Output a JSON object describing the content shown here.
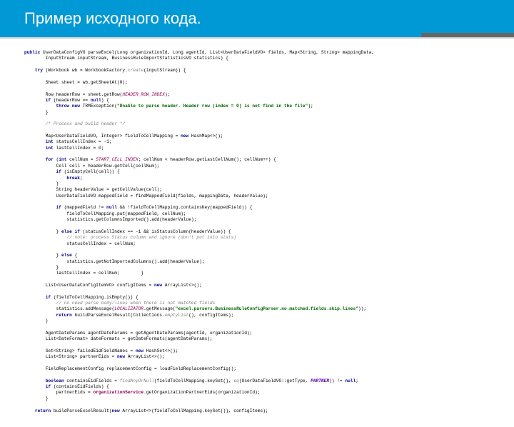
{
  "header": {
    "title": "Пример исходного кода."
  },
  "code": {
    "l01a": "public",
    "l01b": " UserDataConfigVO parseExcel(Long organizationId, Long agentId, List<UserDataFieldVO> fields, Map<String, String> mappingData,",
    "l02": "        InputStream inputStream, BusinessRuleImportStatisticsVO statistics) {",
    "l03a": "    try",
    "l03b": " (Workbook wb = WorkbookFactory.",
    "l03c": "create",
    "l03d": "(inputStream)) {",
    "l04": "        Sheet sheet = wb.getSheetAt(0);",
    "l05a": "        Row headerRow = sheet.getRow(",
    "l05b": "HEADER_ROW_INDEX",
    "l05c": ");",
    "l06a": "        if",
    "l06b": " (headerRow == ",
    "l06c": "null",
    "l06d": ") {",
    "l07a": "            throw new",
    "l07b": " TRMException(",
    "l07c": "\"Unable to parse header. Header row (index = 0) is not find in the file\"",
    "l07d": ");",
    "l08": "        }",
    "l09": "        /* Process and build header */",
    "l10a": "        Map<UserDataFieldVO, Integer> fieldToCellMapping = ",
    "l10b": "new",
    "l10c": " HashMap<>();",
    "l11a": "        int",
    "l11b": " statusCellIndex = -1;",
    "l12a": "        int",
    "l12b": " lastCellIndex = 0;",
    "l13a": "        for",
    "l13b": " (",
    "l13c": "int",
    "l13d": " cellNum = ",
    "l13e": "START_CELL_INDEX",
    "l13f": "; cellNum < headerRow.getLastCellNum(); cellNum++) {",
    "l14": "            Cell cell = headerRow.getCell(cellNum);",
    "l15a": "            if",
    "l15b": " (isEmptyCell(cell)) {",
    "l16": "                break;",
    "l17": "            }",
    "l18": "            String headerValue = getCellValue(cell);",
    "l19": "            UserDataFieldVO mappedField = findMappedField(fields, mappingData, headerValue);",
    "l20a": "            if",
    "l20b": " (mappedField != ",
    "l20c": "null",
    "l20d": " && !fieldToCellMapping.containsKey(mappedField)) {",
    "l21": "                fieldToCellMapping.put(mappedField, cellNum);",
    "l22": "                statistics.getColumnsImported().add(headerValue);",
    "l23a": "            } ",
    "l23b": "else if",
    "l23c": " (statusCellIndex == -1 && isStatusColumn(headerValue)) {",
    "l24": "                // note: process Status column and ignore (don't put into stats)",
    "l25": "                statusCellIndex = cellNum;",
    "l26a": "            } ",
    "l26b": "else",
    "l26c": " {",
    "l27": "                statistics.getNotImportedColumns().add(headerValue);",
    "l28": "            }",
    "l29": "            lastCellIndex = cellNum;        }",
    "l30a": "        List<UserDataConfigItemVO> configItems = ",
    "l30b": "new",
    "l30c": " ArrayList<>();",
    "l31a": "        if",
    "l31b": " (fieldToCellMapping.isEmpty()) {",
    "l32": "            // no need parse body/lines when there is not matched fields",
    "l33a": "            statistics.addMessage(",
    "l33b": "LOCALIZATOR",
    "l33c": ".getMessage(",
    "l33d": "\"excel.parsers.BusinessRuleConfigParser.no.matched.fields.skip.lines\"",
    "l33e": "));",
    "l34a": "            return",
    "l34b": " buildParseExcelResult(Collections.",
    "l34c": "emptyList",
    "l34d": "(), configItems);",
    "l35": "        }",
    "l36": "        AgentDateParams agentDateParams = getAgentDateParams(agentId, organizationId);",
    "l37": "        List<DateFormat> dateFormats = getDateFormats(agentDateParams);",
    "l38a": "        Set<String> failedEidFieldNames = ",
    "l38b": "new",
    "l38c": " HashSet<>();",
    "l39a": "        List<String> partnerEids = ",
    "l39b": "new",
    "l39c": " ArrayList<>();",
    "l40": "        FieldReplacementConfig replacementConfig = loadFieldReplacementConfig();",
    "l41a": "        boolean",
    "l41b": " containsEidFields = ",
    "l41c": "findAnyOrNull",
    "l41d": "(fieldToCellMapping.keySet(), ",
    "l41e": "eq",
    "l41f": "(UserDataFieldVO::getType, ",
    "l41g": "PARTNER",
    "l41h": ")) != ",
    "l41i": "null",
    "l41j": ";",
    "l42a": "        if",
    "l42b": " (containsEidFields) {",
    "l43a": "            partnerEids = ",
    "l43b": "organizationService",
    "l43c": ".getOrganizationPartnerEids(organizationId);",
    "l44": "        }",
    "l45a": "    return",
    "l45b": " buildParseExcelResult(",
    "l45c": "new",
    "l45d": " ArrayList<>(fieldToCellMapping.keySet()), configItems);"
  }
}
